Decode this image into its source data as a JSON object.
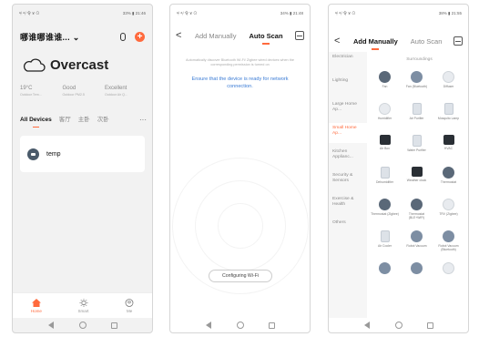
{
  "phone1": {
    "status": {
      "left": "ᵃᵢˡ ᵃᵢˡ 令 ¥ ⊙",
      "right": "33% ▮ 21:46"
    },
    "home_title": "哪谁哪谁谁... ⌄",
    "weather": "Overcast",
    "stats": [
      {
        "value": "19°C",
        "label": "Outdoor Tem..."
      },
      {
        "value": "Good",
        "label": "Outdoor PM2.5"
      },
      {
        "value": "Excellent",
        "label": "Outdoor Air Q..."
      }
    ],
    "tabs": [
      "All Devices",
      "客厅",
      "主卧",
      "次卧"
    ],
    "more": "···",
    "device_name": "temp",
    "bottom_tabs": [
      "Home",
      "Smart",
      "Me"
    ]
  },
  "phone2": {
    "status": {
      "left": "ᵃᵢˡ ᵃᵢˡ 令 ¥ ⊙",
      "right": "34% ▮ 21:48"
    },
    "back": "<",
    "tabs": [
      "Add Manually",
      "Auto Scan"
    ],
    "description": "Automatically discover Bluetooth Wi-Fi/ Zigbee wired devices when the corresponding permission is turned on",
    "ensure": "Ensure that the device is ready for network connection.",
    "config_button": "Configuring Wi-Fi"
  },
  "phone3": {
    "status": {
      "left": "ᵃᵢˡ ᵃᵢˡ 令 ¥ ⊙",
      "right": "38% ▮ 21:55"
    },
    "back": "<",
    "tabs": [
      "Add Manually",
      "Auto Scan"
    ],
    "sidebar": [
      "Electrician",
      "Lighting",
      "Large Home Ap...",
      "Small Home Ap...",
      "Kitchen Applianc...",
      "Security & Sensors",
      "Exercise & Health",
      "Others"
    ],
    "section_title": "Surroundings",
    "items": [
      {
        "label": "Fan",
        "icon": "fan-icon"
      },
      {
        "label": "Fan (Bluetooth)",
        "icon": "fan-icon"
      },
      {
        "label": "Diffuser",
        "icon": "diffuser-icon"
      },
      {
        "label": "Humidifier",
        "icon": "humidifier-icon"
      },
      {
        "label": "Air Purifier",
        "icon": "air-purifier-icon"
      },
      {
        "label": "Mosquito Lamp",
        "icon": "lamp-icon"
      },
      {
        "label": "Air Box",
        "icon": "air-box-icon"
      },
      {
        "label": "Water Purifier",
        "icon": "water-purifier-icon"
      },
      {
        "label": "HVAC",
        "icon": "hvac-icon"
      },
      {
        "label": "Dehumidifier",
        "icon": "dehumidifier-icon"
      },
      {
        "label": "Weather clock",
        "icon": "clock-icon"
      },
      {
        "label": "Thermostat",
        "icon": "thermostat-icon"
      },
      {
        "label": "Thermostat (Zigbee)",
        "icon": "thermostat-icon"
      },
      {
        "label": "Thermostat (BLE+WiFi)",
        "icon": "thermostat-icon"
      },
      {
        "label": "TRV (Zigbee)",
        "icon": "trv-icon"
      },
      {
        "label": "Air Cooler",
        "icon": "air-cooler-icon"
      },
      {
        "label": "Robot Vacuum",
        "icon": "robot-vacuum-icon"
      },
      {
        "label": "Robot Vacuum (Bluetooth)",
        "icon": "robot-vacuum-icon"
      },
      {
        "label": "",
        "icon": "device-icon"
      },
      {
        "label": "",
        "icon": "device-icon"
      },
      {
        "label": "",
        "icon": "device-icon"
      }
    ]
  }
}
